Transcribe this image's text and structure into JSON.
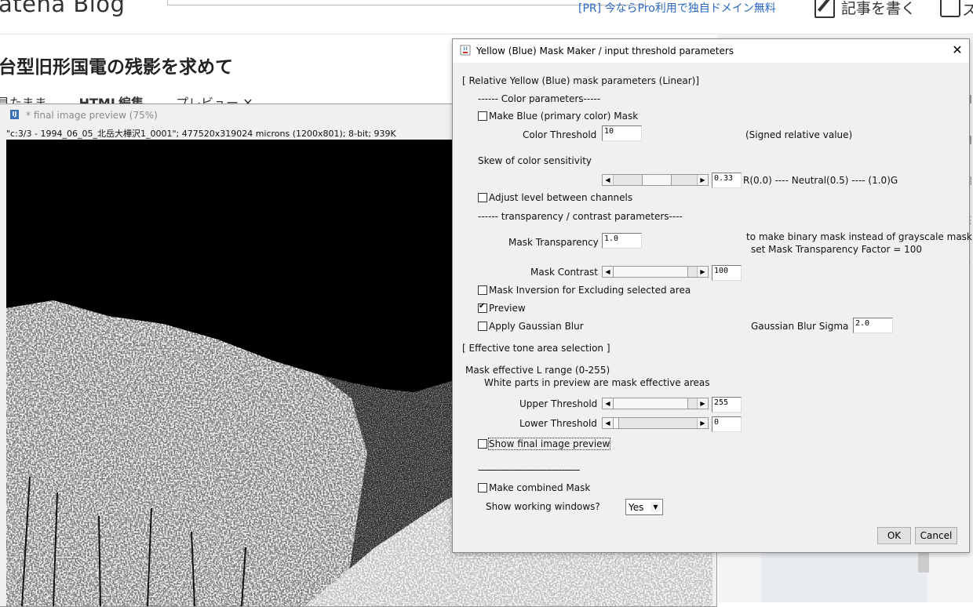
{
  "blog": {
    "logo": "atena Blog",
    "pr_link": "[PR] 今ならPro利用で独自ドメイン無料",
    "write_button": "記事を書く",
    "edge_char": "ス",
    "title": "台型旧形国電の残影を求めて",
    "tabs": [
      "見たまま",
      "HTML編集",
      "プレビュー ✕"
    ]
  },
  "preview_window": {
    "title": "* final image preview (75%)",
    "app_icon": "imagej-icon",
    "info": "\"c:3/3 - 1994_06_05_北岳大樺沢1_0001\"; 477520x319024 microns (1200x801); 8-bit; 939K"
  },
  "dialog": {
    "title": "Yellow (Blue) Mask Maker / input threshold parameters",
    "close": "✕",
    "section_relative": "[ Relative Yellow (Blue) mask parameters (Linear)]",
    "color_params_header": "------ Color parameters-----",
    "make_blue_mask": {
      "label": "Make Blue (primary color) Mask",
      "checked": false
    },
    "color_threshold": {
      "label": "Color Threshold",
      "value": "10",
      "note": "(Signed relative value)"
    },
    "skew_label": "Skew of color sensitivity",
    "skew": {
      "value": "0.33",
      "note": "R(0.0) ---- Neutral(0.5) ---- (1.0)G",
      "level": 0.33
    },
    "adjust_level": {
      "label": "Adjust level between channels",
      "checked": false
    },
    "transparency_header": "------ transparency / contrast parameters----",
    "mask_transparency": {
      "label": "Mask Transparency",
      "value": "1.0",
      "note1": "to make binary mask instead of grayscale mask,",
      "note2": "set Mask Transparency Factor = 100"
    },
    "mask_contrast": {
      "label": "Mask Contrast",
      "value": "100",
      "level": 1.0
    },
    "mask_inversion": {
      "label": "Mask Inversion for Excluding selected area",
      "checked": false
    },
    "preview": {
      "label": "Preview",
      "checked": true
    },
    "gaussian_blur": {
      "label": "Apply Gaussian Blur",
      "checked": false
    },
    "gaussian_sigma": {
      "label": "Gaussian Blur Sigma",
      "value": "2.0"
    },
    "section_tone": "[ Effective tone area selection ]",
    "l_range_label": "Mask effective L range (0-255)",
    "white_parts_note": "White parts in preview are mask effective areas",
    "upper_threshold": {
      "label": "Upper Threshold",
      "value": "255",
      "level": 1.0
    },
    "lower_threshold": {
      "label": "Lower Threshold",
      "value": "0",
      "level": 0.0
    },
    "show_final": {
      "label": "Show final image preview",
      "checked": false
    },
    "divider": "----------------------------------------",
    "make_combined": {
      "label": "Make combined Mask",
      "checked": false
    },
    "show_working": {
      "label": "Show working windows?",
      "value": "Yes"
    },
    "ok": "OK",
    "cancel": "Cancel"
  }
}
